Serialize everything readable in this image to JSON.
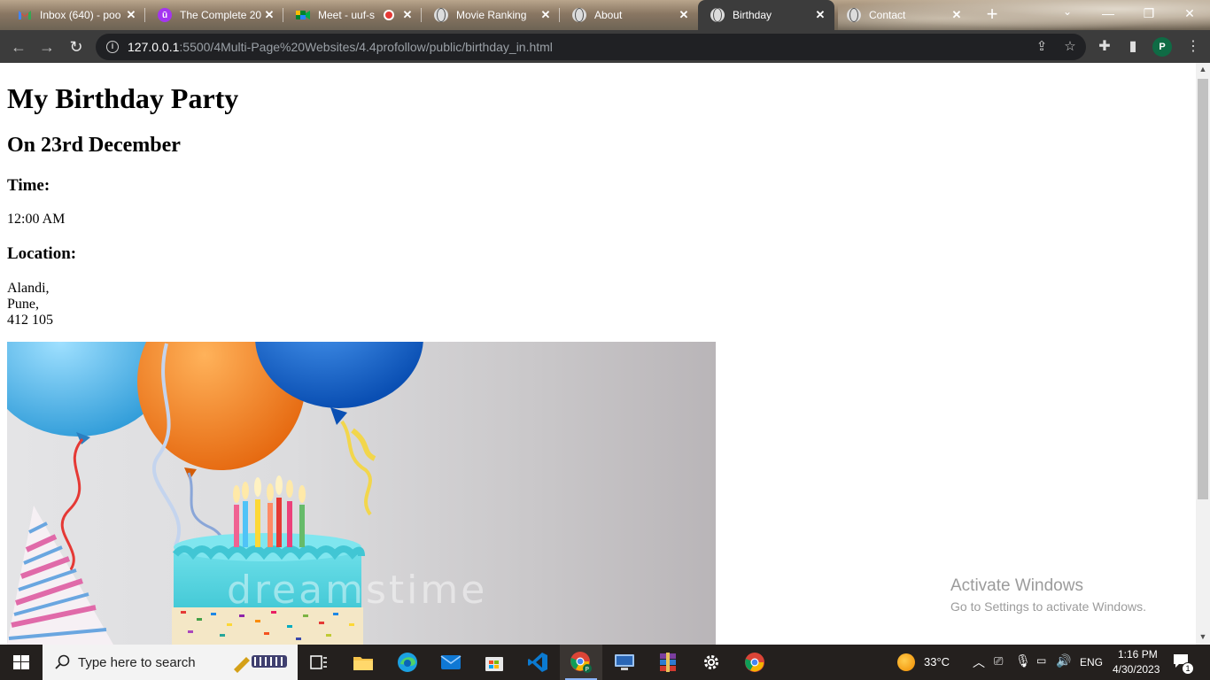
{
  "browser": {
    "tabs": [
      {
        "title": "Inbox (640) - poo",
        "icon": "gmail-icon",
        "active": false
      },
      {
        "title": "The Complete 20",
        "icon": "udemy-icon",
        "active": false
      },
      {
        "title": "Meet - uuf-sh",
        "icon": "meet-icon",
        "active": false,
        "recording": true
      },
      {
        "title": "Movie Ranking",
        "icon": "globe-icon",
        "active": false
      },
      {
        "title": "About",
        "icon": "globe-icon",
        "active": false
      },
      {
        "title": "Birthday",
        "icon": "globe-icon",
        "active": true
      },
      {
        "title": "Contact",
        "icon": "globe-icon",
        "active": false
      }
    ],
    "tab_close_glyph": "✕",
    "new_tab_glyph": "+",
    "address": {
      "host": "127.0.0.1",
      "path": ":5500/4Multi-Page%20Websites/4.4profollow/public/birthday_in.html"
    },
    "profile_initial": "P"
  },
  "page": {
    "heading": "My Birthday Party",
    "subheading": "On 23rd December",
    "time_label": "Time:",
    "time_value": "12:00 AM",
    "location_label": "Location:",
    "location_lines": [
      "Alandi,",
      "Pune,",
      "412 105"
    ],
    "image_watermark": "dreamstime"
  },
  "activation": {
    "title": "Activate Windows",
    "subtitle": "Go to Settings to activate Windows."
  },
  "taskbar": {
    "search_placeholder": "Type here to search",
    "weather_temp": "33°C",
    "language": "ENG",
    "time": "1:16 PM",
    "date": "4/30/2023",
    "notification_count": "1"
  },
  "colors": {
    "tab_strip": "#8a7763",
    "toolbar": "#3c3c3c",
    "omnibox": "#202124",
    "taskbar": "#24201e",
    "profile": "#0f6b45"
  }
}
